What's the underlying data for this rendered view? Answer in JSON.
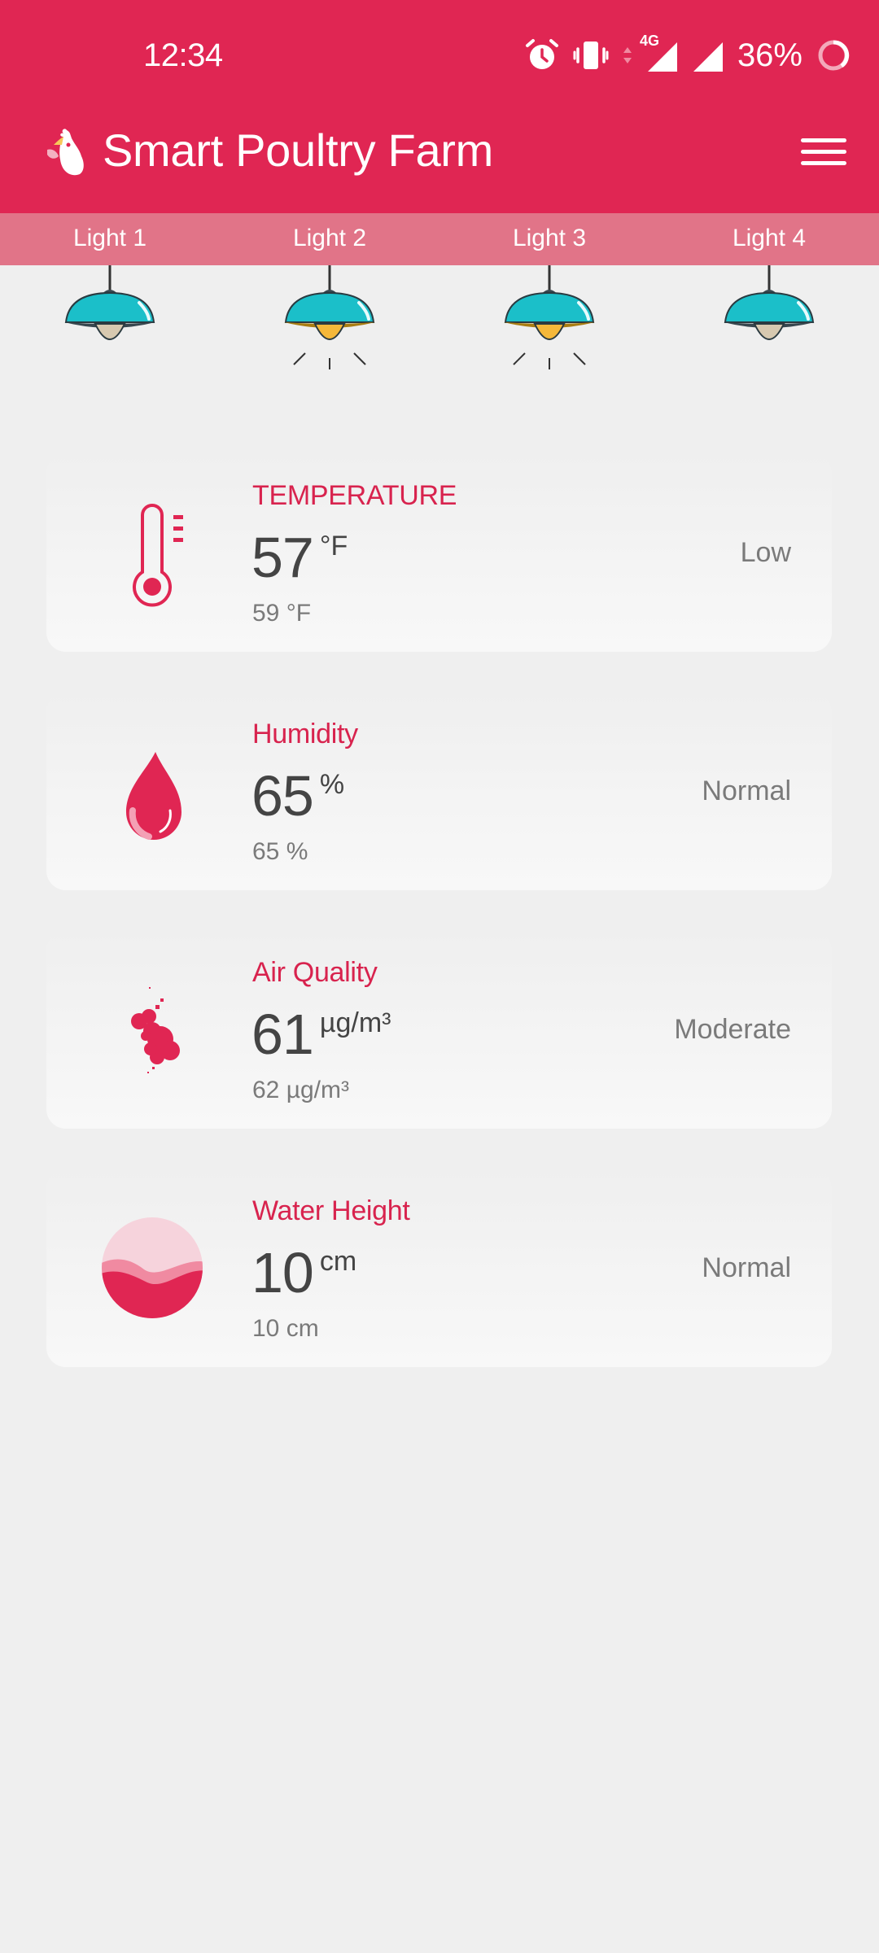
{
  "status_bar": {
    "time": "12:34",
    "network": "4G",
    "battery": "36%",
    "icons": [
      "alarm-icon",
      "vibrate-icon",
      "data-arrows-icon",
      "signal-icon",
      "signal-icon",
      "battery-ring-icon"
    ]
  },
  "app_bar": {
    "title": "Smart Poultry Farm",
    "logo_icon": "rooster-logo-icon",
    "menu_icon": "hamburger-menu-icon"
  },
  "lights": [
    {
      "label": "Light 1",
      "on": false
    },
    {
      "label": "Light 2",
      "on": true
    },
    {
      "label": "Light 3",
      "on": true
    },
    {
      "label": "Light 4",
      "on": false
    }
  ],
  "cards": [
    {
      "title": "TEMPERATURE",
      "value": "57",
      "unit": "°F",
      "sub": "59 °F",
      "status": "Low",
      "icon": "thermometer-icon"
    },
    {
      "title": "Humidity",
      "value": "65",
      "unit": "%",
      "sub": "65 %",
      "status": "Normal",
      "icon": "water-drop-icon"
    },
    {
      "title": "Air Quality",
      "value": "61",
      "unit": "µg/m³",
      "sub": "62 µg/m³",
      "status": "Moderate",
      "icon": "smoke-particles-icon"
    },
    {
      "title": "Water Height",
      "value": "10",
      "unit": "cm",
      "sub": "10 cm",
      "status": "Normal",
      "icon": "water-level-icon"
    }
  ],
  "colors": {
    "primary": "#e02653",
    "lights_bar": "#e17488",
    "lamp_shade": "#1bbfc9",
    "lamp_on_bulb": "#f5b83a",
    "accent_text": "#d8234e",
    "background": "#efefef"
  }
}
